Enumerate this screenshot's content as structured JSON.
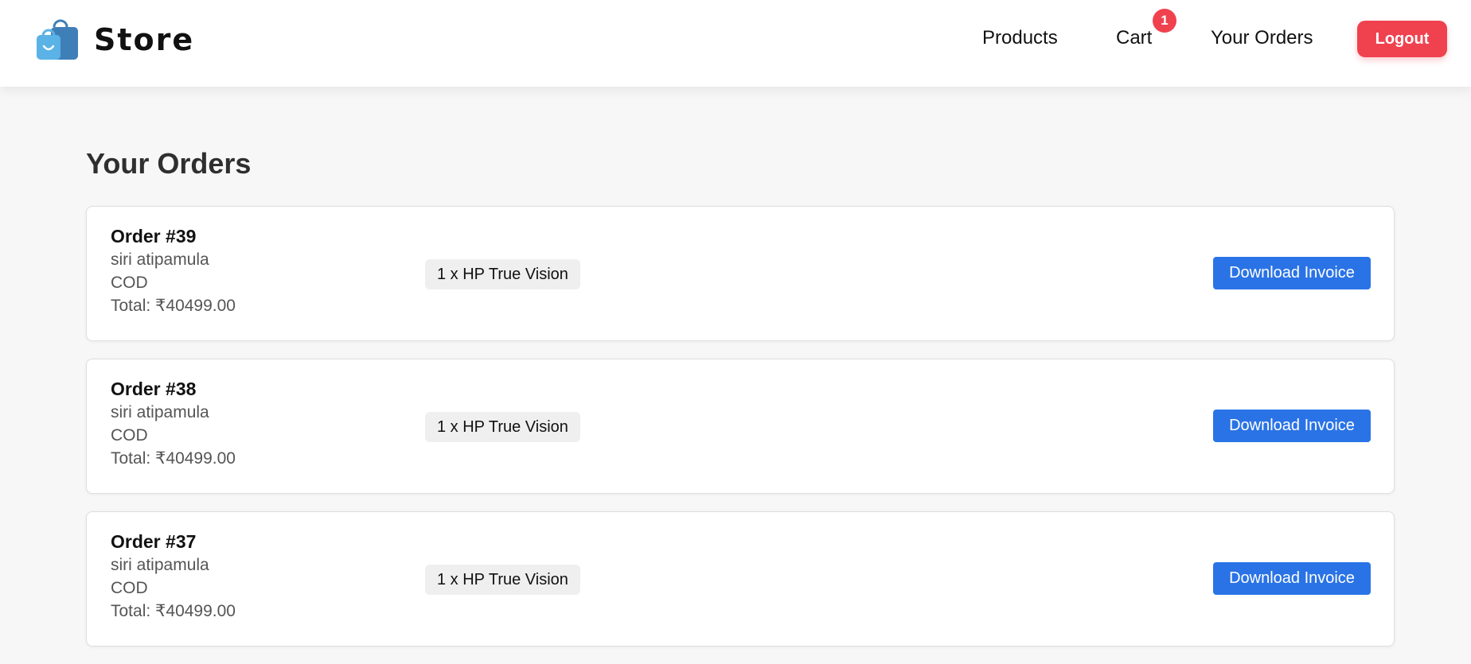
{
  "header": {
    "brand": "Store",
    "nav": {
      "products": "Products",
      "cart": "Cart",
      "cart_count": "1",
      "orders": "Your Orders",
      "logout": "Logout"
    },
    "logo_icon": "shopping-bags-icon"
  },
  "main": {
    "title": "Your Orders",
    "orders": [
      {
        "id": "Order #39",
        "customer": "siri atipamula",
        "payment": "COD",
        "total": "Total: ₹40499.00",
        "item": "1 x HP True Vision",
        "action": "Download Invoice"
      },
      {
        "id": "Order #38",
        "customer": "siri atipamula",
        "payment": "COD",
        "total": "Total: ₹40499.00",
        "item": "1 x HP True Vision",
        "action": "Download Invoice"
      },
      {
        "id": "Order #37",
        "customer": "siri atipamula",
        "payment": "COD",
        "total": "Total: ₹40499.00",
        "item": "1 x HP True Vision",
        "action": "Download Invoice"
      }
    ]
  },
  "colors": {
    "accent": "#2a73e6",
    "danger": "#f0414f",
    "background": "#f7f7f7"
  }
}
